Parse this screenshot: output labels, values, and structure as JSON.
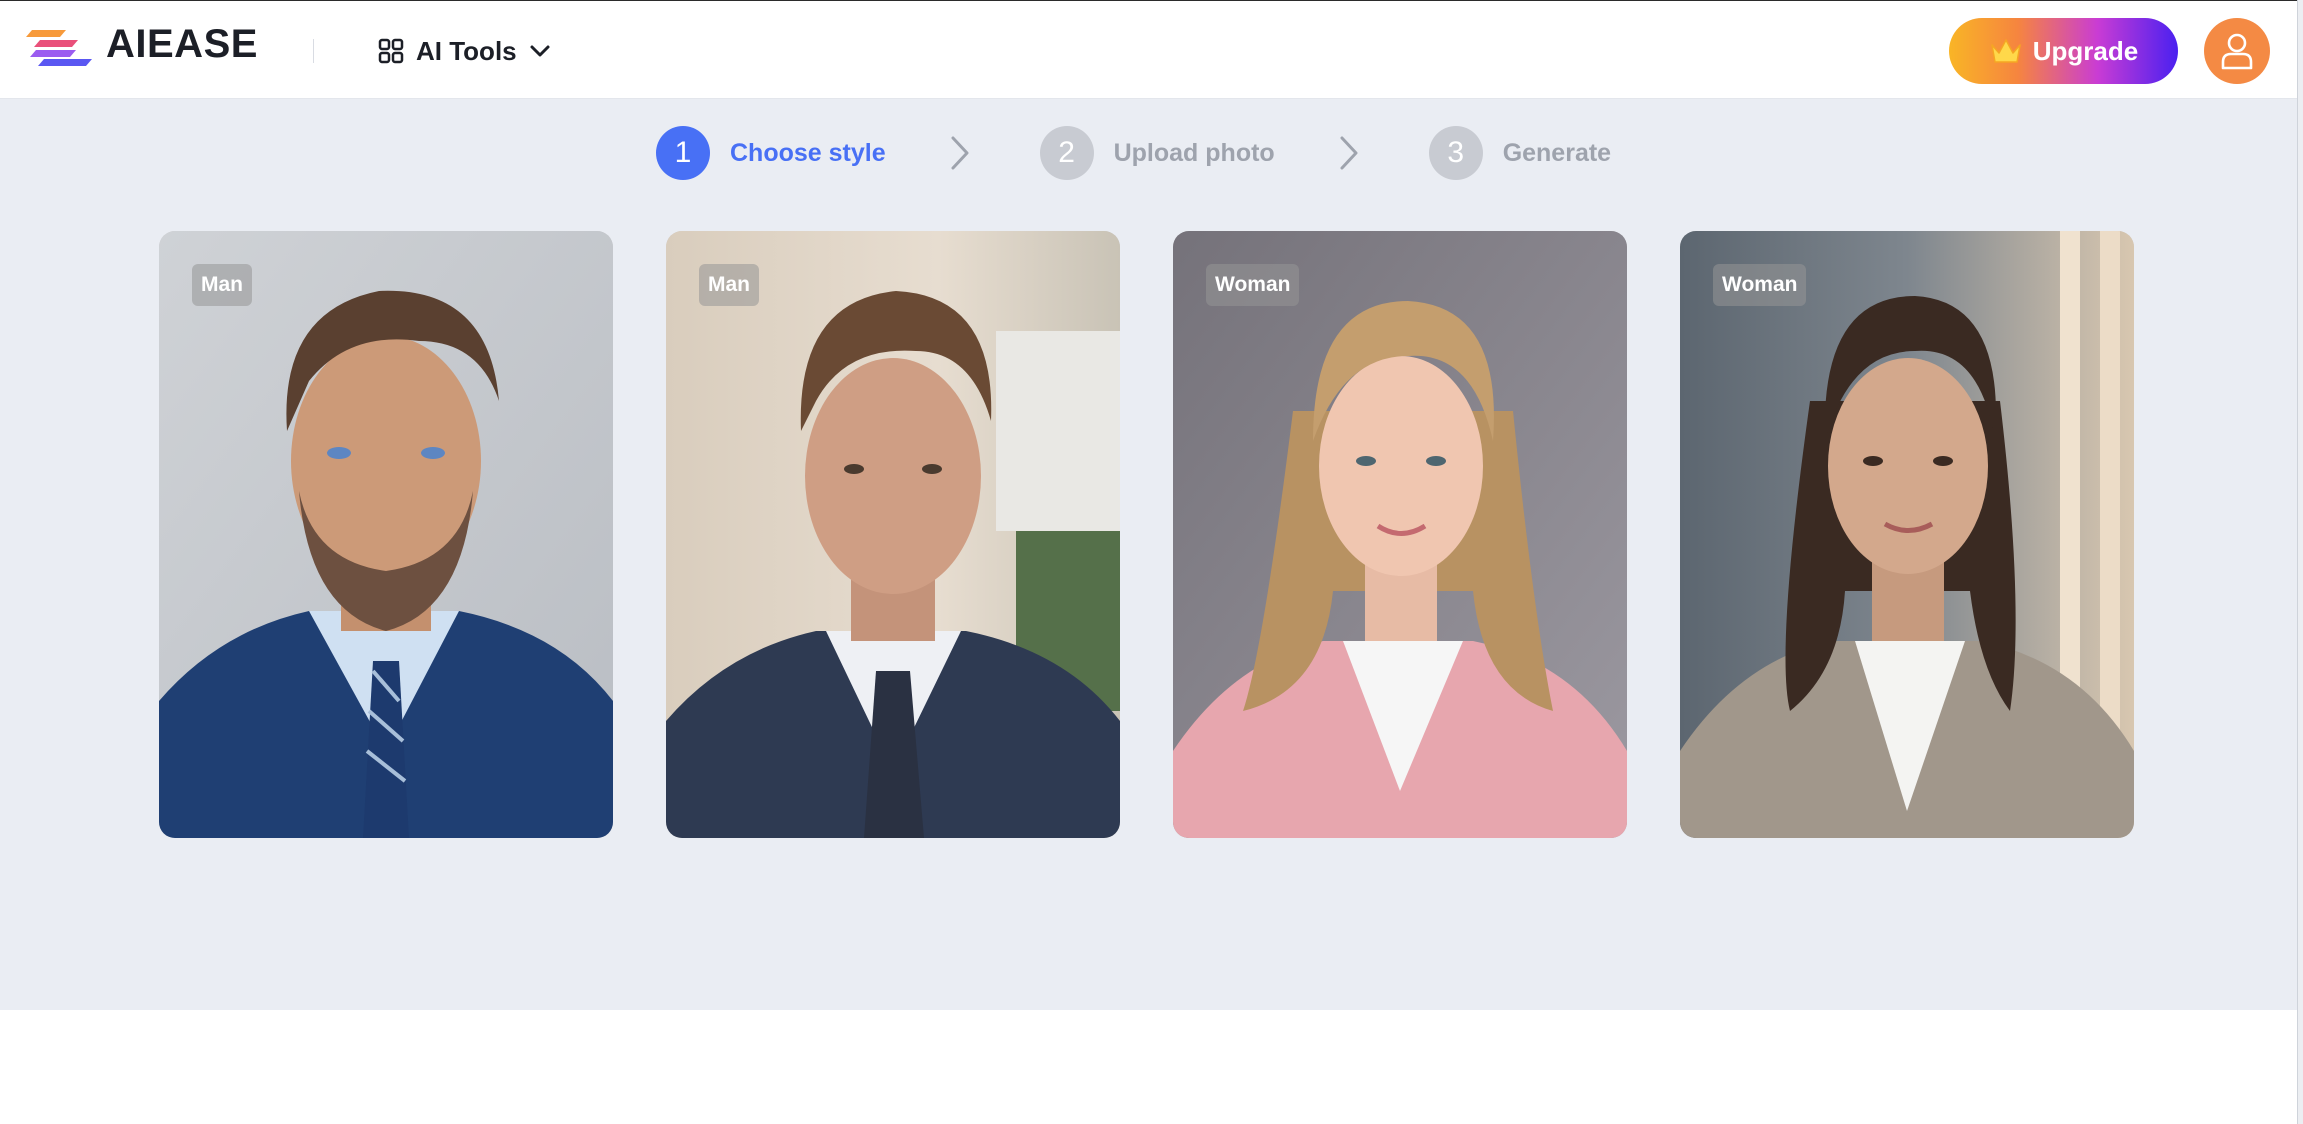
{
  "header": {
    "logo_text": "AIEASE",
    "tools_label": "AI Tools",
    "upgrade_label": "Upgrade"
  },
  "steps": [
    {
      "number": "1",
      "label": "Choose style",
      "state": "active"
    },
    {
      "number": "2",
      "label": "Upload photo",
      "state": "inactive"
    },
    {
      "number": "3",
      "label": "Generate",
      "state": "inactive"
    }
  ],
  "cards": [
    {
      "tag": "Man",
      "subject": "man-navy-suit-portrait"
    },
    {
      "tag": "Man",
      "subject": "young-man-suit-portrait"
    },
    {
      "tag": "Woman",
      "subject": "woman-pink-blazer-portrait"
    },
    {
      "tag": "Woman",
      "subject": "woman-beige-blazer-portrait"
    }
  ],
  "colors": {
    "accent": "#4870f5",
    "background": "#eaedf3",
    "avatar": "#f48a44"
  }
}
